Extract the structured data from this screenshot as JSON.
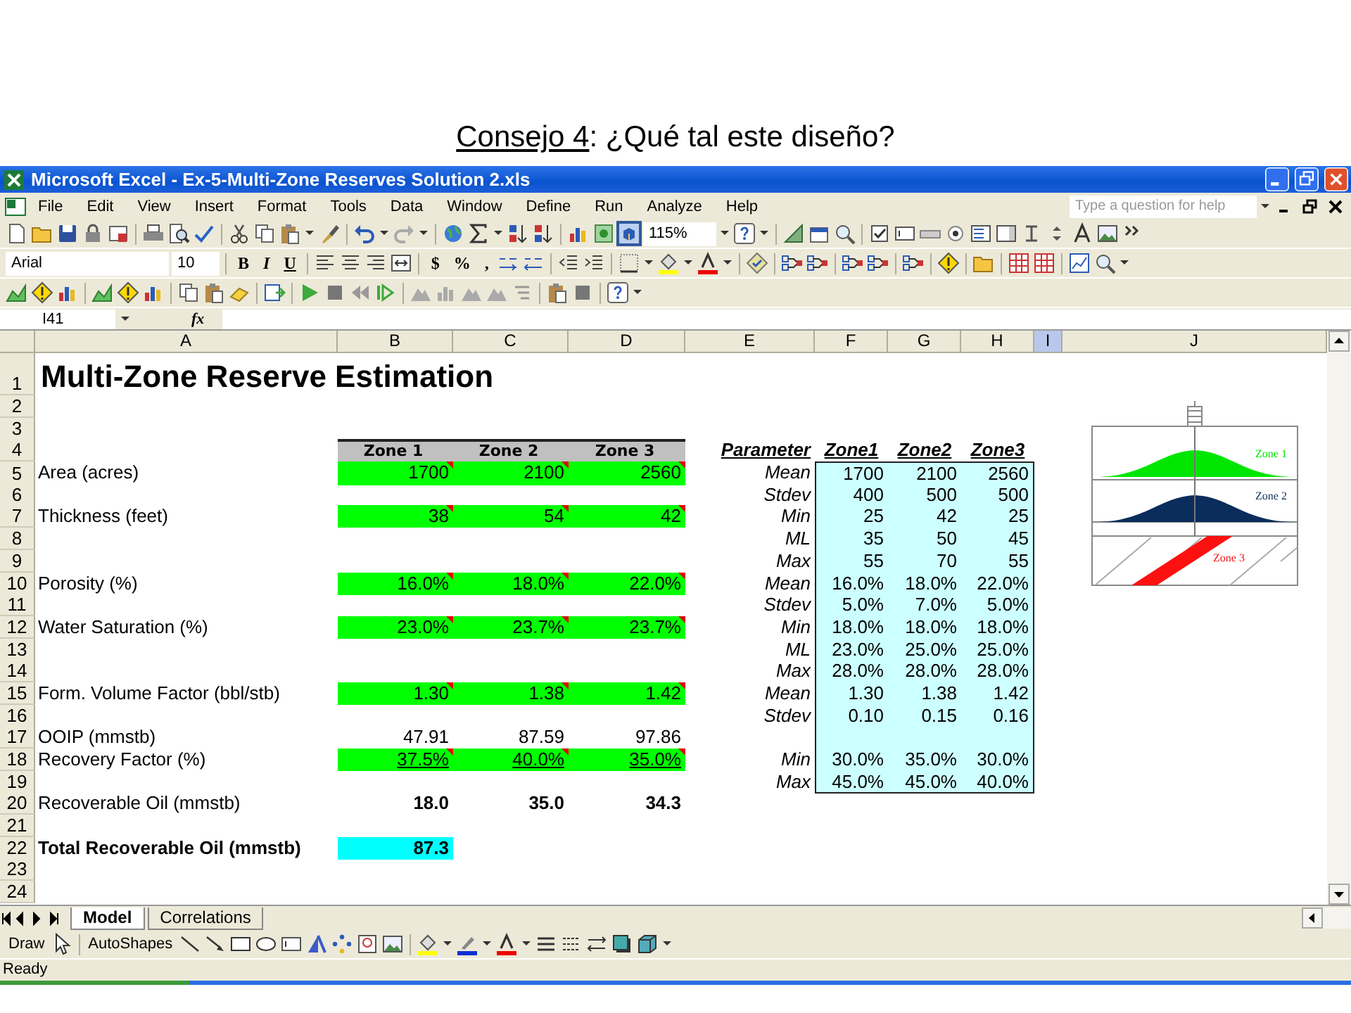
{
  "slide": {
    "title_link": "Consejo 4",
    "title_rest": ": ¿Qué tal este diseño?"
  },
  "window": {
    "title": "Microsoft Excel - Ex-5-Multi-Zone Reserves Solution 2.xls"
  },
  "menu": [
    "File",
    "Edit",
    "View",
    "Insert",
    "Format",
    "Tools",
    "Data",
    "Window",
    "Define",
    "Run",
    "Analyze",
    "Help"
  ],
  "help_search": {
    "placeholder": "Type a question for help"
  },
  "toolbar": {
    "zoom": "115%",
    "font": "Arial",
    "size": "10",
    "format_buttons": [
      "B",
      "I",
      "U"
    ],
    "number_buttons": [
      "$",
      "%",
      ","
    ]
  },
  "formula_bar": {
    "name_box": "I41",
    "fx": "fx"
  },
  "sheet": {
    "columns": [
      {
        "label": "A",
        "selected": false
      },
      {
        "label": "B",
        "selected": false
      },
      {
        "label": "C",
        "selected": false
      },
      {
        "label": "D",
        "selected": false
      },
      {
        "label": "E",
        "selected": false
      },
      {
        "label": "F",
        "selected": false
      },
      {
        "label": "G",
        "selected": false
      },
      {
        "label": "H",
        "selected": false
      },
      {
        "label": "I",
        "selected": true
      },
      {
        "label": "J",
        "selected": false
      }
    ],
    "rows": [
      {
        "number": "1",
        "title": "Multi-Zone Reserve Estimation"
      },
      {
        "number": "2"
      },
      {
        "number": "3"
      },
      {
        "number": "4",
        "kind": "header",
        "values": [
          "Zone 1",
          "Zone 2",
          "Zone 3"
        ],
        "param": "Parameter",
        "dist": [
          "Zone1",
          "Zone2",
          "Zone3"
        ]
      },
      {
        "number": "5",
        "kind": "input",
        "label": "Area (acres)",
        "values": [
          "1700",
          "2100",
          "2560"
        ],
        "param": "Mean",
        "dist": [
          "1700",
          "2100",
          "2560"
        ]
      },
      {
        "number": "6",
        "param": "Stdev",
        "dist": [
          "400",
          "500",
          "500"
        ]
      },
      {
        "number": "7",
        "kind": "input",
        "label": "Thickness (feet)",
        "values": [
          "38",
          "54",
          "42"
        ],
        "param": "Min",
        "dist": [
          "25",
          "42",
          "25"
        ]
      },
      {
        "number": "8",
        "param": "ML",
        "dist": [
          "35",
          "50",
          "45"
        ]
      },
      {
        "number": "9",
        "param": "Max",
        "dist": [
          "55",
          "70",
          "55"
        ]
      },
      {
        "number": "10",
        "kind": "input",
        "label": "Porosity (%)",
        "values": [
          "16.0%",
          "18.0%",
          "22.0%"
        ],
        "param": "Mean",
        "dist": [
          "16.0%",
          "18.0%",
          "22.0%"
        ]
      },
      {
        "number": "11",
        "param": "Stdev",
        "dist": [
          "5.0%",
          "7.0%",
          "5.0%"
        ]
      },
      {
        "number": "12",
        "kind": "input",
        "label": "Water Saturation (%)",
        "values": [
          "23.0%",
          "23.7%",
          "23.7%"
        ],
        "param": "Min",
        "dist": [
          "18.0%",
          "18.0%",
          "18.0%"
        ]
      },
      {
        "number": "13",
        "param": "ML",
        "dist": [
          "23.0%",
          "25.0%",
          "25.0%"
        ]
      },
      {
        "number": "14",
        "param": "Max",
        "dist": [
          "28.0%",
          "28.0%",
          "28.0%"
        ]
      },
      {
        "number": "15",
        "kind": "input",
        "label": "Form. Volume Factor (bbl/stb)",
        "values": [
          "1.30",
          "1.38",
          "1.42"
        ],
        "param": "Mean",
        "dist": [
          "1.30",
          "1.38",
          "1.42"
        ]
      },
      {
        "number": "16",
        "param": "Stdev",
        "dist": [
          "0.10",
          "0.15",
          "0.16"
        ]
      },
      {
        "number": "17",
        "kind": "calc",
        "label": "OOIP (mmstb)",
        "values": [
          "47.91",
          "87.59",
          "97.86"
        ]
      },
      {
        "number": "18",
        "kind": "input",
        "underline": true,
        "label": "Recovery Factor (%)",
        "values": [
          "37.5%",
          "40.0%",
          "35.0%"
        ],
        "param": "Min",
        "dist": [
          "30.0%",
          "35.0%",
          "30.0%"
        ]
      },
      {
        "number": "19",
        "param": "Max",
        "dist": [
          "45.0%",
          "45.0%",
          "40.0%"
        ]
      },
      {
        "number": "20",
        "kind": "result",
        "label": "Recoverable Oil (mmstb)",
        "values": [
          "18.0",
          "35.0",
          "34.3"
        ]
      },
      {
        "number": "21"
      },
      {
        "number": "22",
        "kind": "total",
        "label": "Total Recoverable Oil (mmstb)",
        "values": [
          "87.3"
        ]
      },
      {
        "number": "23"
      },
      {
        "number": "24"
      }
    ],
    "diagram": {
      "zones": [
        {
          "label": "Zone 1",
          "color": "#00e600",
          "kind": "dome"
        },
        {
          "label": "Zone 2",
          "color": "#0b2d5c",
          "kind": "dome"
        },
        {
          "label": "Zone 3",
          "color": "#ff1010",
          "kind": "bed"
        }
      ]
    }
  },
  "sheet_tabs": [
    {
      "label": "Model",
      "selected": true
    },
    {
      "label": "Correlations",
      "selected": false
    }
  ],
  "drawing_toolbar": {
    "draw": "Draw",
    "autoshapes": "AutoShapes"
  },
  "status_bar": "Ready"
}
